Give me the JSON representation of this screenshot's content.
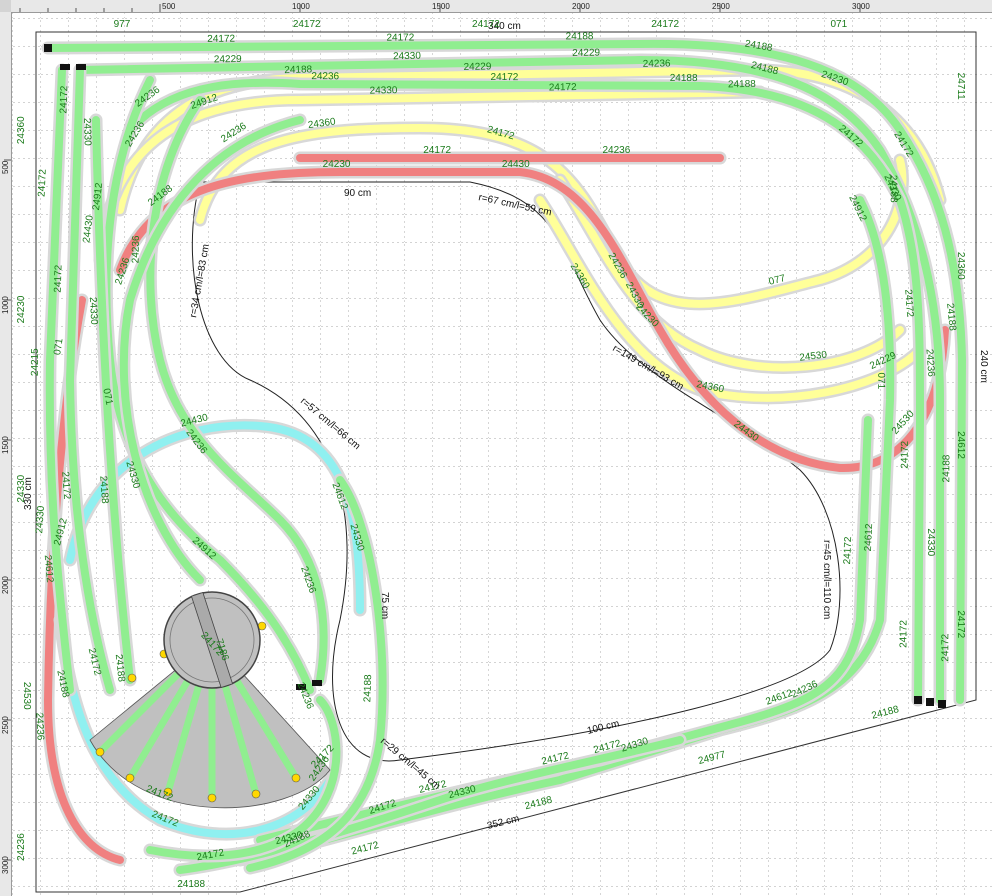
{
  "rulers": {
    "x_ticks": [
      "500",
      "1000",
      "1500",
      "2000",
      "2500",
      "3000"
    ],
    "y_ticks": [
      "500",
      "1000",
      "1500",
      "2000",
      "2500",
      "3000"
    ]
  },
  "dimensions": {
    "top": "340 cm",
    "left": "330 cm",
    "right": "240 cm",
    "bottom": "352 cm",
    "inner_bottom": "100 cm",
    "middle": "75 cm",
    "upper_loop": "90 cm"
  },
  "radius_labels": {
    "r1": "r=67 cm/l=59 cm",
    "r2": "r=34 cm/l=83 cm",
    "r3": "r=149 cm/l=93 cm",
    "r4": "r=45 cm/l=110 cm",
    "r5": "r=29 cm/l=45 cm",
    "r6": "r=57 cm/l=66 cm"
  },
  "part_labels": [
    "977",
    "24172",
    "24172",
    "24172",
    "071",
    "24711",
    "24360",
    "24612",
    "24172",
    "24188",
    "24977",
    "24188",
    "24172",
    "24188",
    "24236",
    "24530",
    "24330",
    "24230",
    "24360",
    "24236",
    "24188",
    "24229",
    "24236",
    "24230",
    "24430",
    "24912",
    "24330",
    "24172",
    "24188",
    "24360",
    "24172",
    "24236",
    "077",
    "24188",
    "24230",
    "24530",
    "24360",
    "24360",
    "24229",
    "24172",
    "24236",
    "24188",
    "24230",
    "24430",
    "24330",
    "24430",
    "24530",
    "071",
    "24330",
    "24236",
    "24912",
    "24430",
    "24612",
    "24188",
    "24172",
    "24236",
    "24172",
    "24172",
    "24188",
    "24188",
    "24172",
    "24188",
    "24188",
    "24172",
    "24229",
    "24330",
    "24229",
    "24188",
    "24330",
    "24236",
    "24330",
    "24236",
    "24236",
    "24172",
    "24188",
    "24172",
    "24172",
    "24172",
    "24172",
    "24172",
    "24215",
    "24612",
    "24172",
    "24172",
    "24172",
    "24172",
    "24912",
    "071",
    "24912",
    "24236",
    "24236",
    "24236",
    "24236",
    "24236",
    "24236",
    "24330",
    "24330",
    "24330",
    "24330",
    "24236",
    "24612",
    "071",
    "24912",
    "24172",
    "24172",
    "24612",
    "24172",
    "24172",
    "24172",
    "24172",
    "24188",
    "24188",
    "24330",
    "24330",
    "24330",
    "24330",
    "24188",
    "24188",
    "24172",
    "24172",
    "24172"
  ],
  "colors": {
    "track_green": "#90ee90",
    "track_yellow": "#ffff99",
    "track_red": "#f08080",
    "track_cyan": "#8ff0f0",
    "turntable": "#c0c0c0",
    "label_green": "#1b7b1b"
  },
  "turntable": {
    "label": "7186"
  }
}
